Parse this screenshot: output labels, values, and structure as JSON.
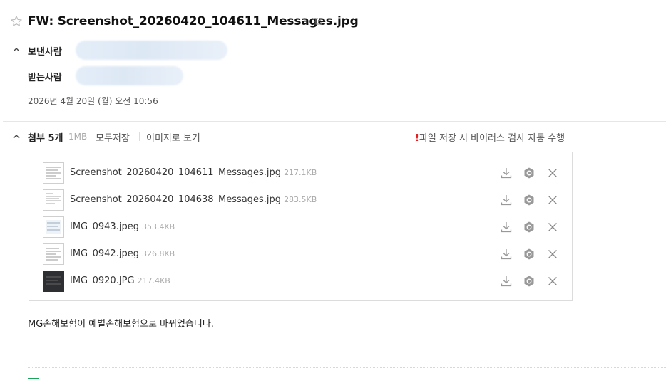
{
  "header": {
    "subject": "FW: Screenshot_20260420_104611_Messages.jpg",
    "icons": {
      "star": "star-icon",
      "popout": "external-link-icon"
    }
  },
  "meta": {
    "sender_label": "보낸사람",
    "recipient_label": "받는사람",
    "date": "2026년 4월 20일 (월) 오전 10:56"
  },
  "attachments": {
    "title": "첨부 5개",
    "total_size": "1MB",
    "save_all": "모두저장",
    "view_images": "이미지로 보기",
    "warning_mark": "!",
    "warning": "파일 저장 시 바이러스 검사 자동 수행",
    "files": [
      {
        "name": "Screenshot_20260420_104611_Messages.jpg",
        "size": "217.1KB",
        "thumb": "light"
      },
      {
        "name": "Screenshot_20260420_104638_Messages.jpg",
        "size": "283.5KB",
        "thumb": "light"
      },
      {
        "name": "IMG_0943.jpeg",
        "size": "353.4KB",
        "thumb": "light"
      },
      {
        "name": "IMG_0942.jpeg",
        "size": "326.8KB",
        "thumb": "light"
      },
      {
        "name": "IMG_0920.JPG",
        "size": "217.4KB",
        "thumb": "dark"
      }
    ]
  },
  "body": {
    "text": "MG손해보험이 예별손해보험으로 바뀌었습니다."
  },
  "colors": {
    "warning": "#e02020",
    "accent_green": "#19a55a",
    "blur_chip": "#e4eef9"
  }
}
